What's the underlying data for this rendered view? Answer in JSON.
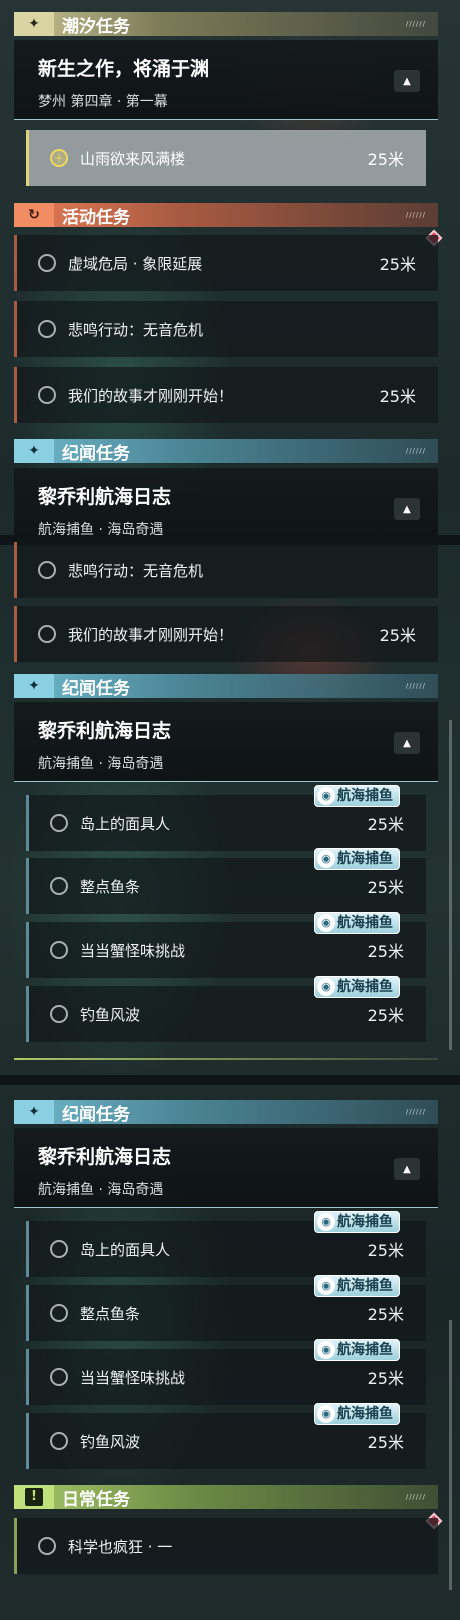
{
  "panel1": {
    "cat_tide": {
      "label": "潮汐任务"
    },
    "chapter_tide": {
      "title": "新生之作，将涌于渊",
      "subtitle": "梦州 第四章 · 第一幕"
    },
    "task_tide": {
      "name": "山雨欲来风满楼",
      "distance": "25米"
    },
    "cat_activity": {
      "label": "活动任务"
    },
    "activity_tasks": [
      {
        "name": "虚域危局 · 象限延展",
        "distance": "25米"
      },
      {
        "name": "悲鸣行动：无音危机",
        "distance": ""
      },
      {
        "name": "我们的故事才刚刚开始！",
        "distance": "25米"
      }
    ],
    "cat_lore": {
      "label": "纪闻任务"
    },
    "chapter_lore": {
      "title": "黎乔利航海日志",
      "subtitle": "航海捕鱼 · 海岛奇遇"
    }
  },
  "panel2": {
    "activity_tasks": [
      {
        "name": "悲鸣行动：无音危机",
        "distance": ""
      },
      {
        "name": "我们的故事才刚刚开始！",
        "distance": "25米"
      }
    ],
    "cat_lore": {
      "label": "纪闻任务"
    },
    "chapter_lore": {
      "title": "黎乔利航海日志",
      "subtitle": "航海捕鱼 · 海岛奇遇"
    },
    "lore_tasks": [
      {
        "name": "岛上的面具人",
        "distance": "25米",
        "badge": "航海捕鱼"
      },
      {
        "name": "整点鱼条",
        "distance": "25米",
        "badge": "航海捕鱼"
      },
      {
        "name": "当当蟹怪味挑战",
        "distance": "25米",
        "badge": "航海捕鱼"
      },
      {
        "name": "钓鱼风波",
        "distance": "25米",
        "badge": "航海捕鱼"
      }
    ]
  },
  "panel3": {
    "cat_lore": {
      "label": "纪闻任务"
    },
    "chapter_lore": {
      "title": "黎乔利航海日志",
      "subtitle": "航海捕鱼 · 海岛奇遇"
    },
    "lore_tasks": [
      {
        "name": "岛上的面具人",
        "distance": "25米",
        "badge": "航海捕鱼"
      },
      {
        "name": "整点鱼条",
        "distance": "25米",
        "badge": "航海捕鱼"
      },
      {
        "name": "当当蟹怪味挑战",
        "distance": "25米",
        "badge": "航海捕鱼"
      },
      {
        "name": "钓鱼风波",
        "distance": "25米",
        "badge": "航海捕鱼"
      }
    ],
    "cat_daily": {
      "label": "日常任务"
    },
    "daily_tasks": [
      {
        "name": "科学也疯狂 · 一",
        "distance": ""
      }
    ]
  },
  "icons": {
    "tide": "sparkle-icon",
    "activity": "refresh-icon",
    "lore": "sparkle-icon",
    "daily": "exclamation-icon",
    "collapse": "chevron-up-icon",
    "task": "circle-icon",
    "tracked": "plus-circle-icon",
    "badge": "fish-icon",
    "marker": "diamond-icon"
  },
  "colors": {
    "tide": "#c8c494",
    "activity": "#e77b56",
    "lore": "#6fb8cc",
    "daily": "#a7c86a",
    "tracked_task": "#f0d95a",
    "marker": "#d6445a"
  }
}
